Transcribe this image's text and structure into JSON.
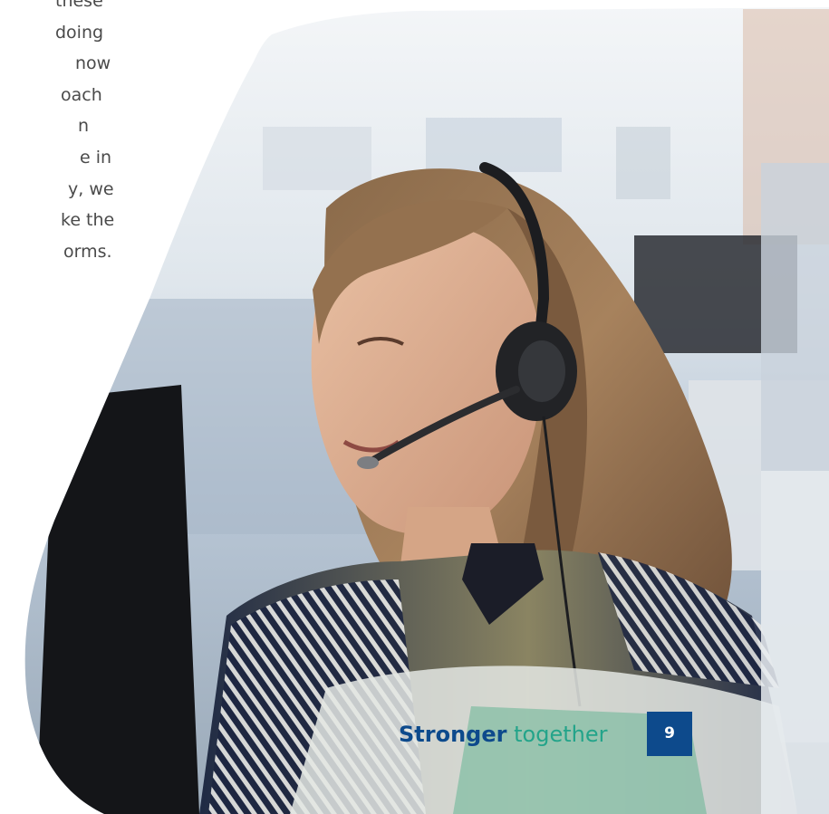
{
  "body_text": {
    "lines": [
      "these",
      "doing",
      "now",
      "oach",
      "n",
      "e in",
      "y, we",
      "ke the",
      "orms."
    ]
  },
  "footer": {
    "tagline_strong": "Stronger",
    "tagline_light": "together",
    "page_number": "9"
  },
  "colors": {
    "brand_blue": "#0d4a8c",
    "brand_green": "#23a48a",
    "body_text": "#4a4a4a"
  }
}
